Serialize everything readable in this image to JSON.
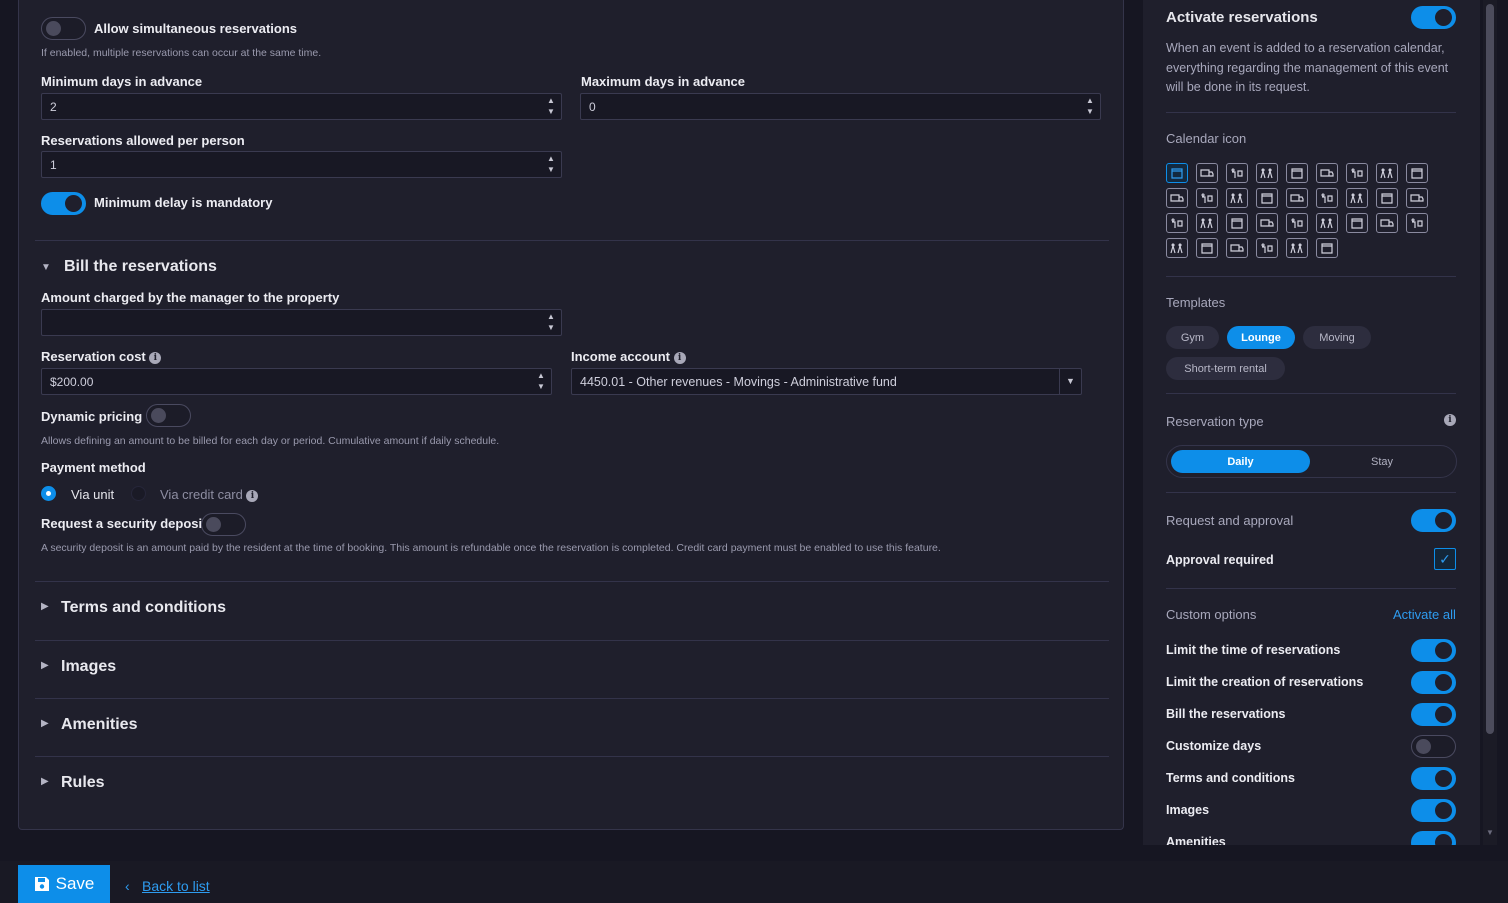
{
  "form": {
    "simultaneous": {
      "label": "Allow simultaneous reservations",
      "help": "If enabled, multiple reservations can occur at the same time."
    },
    "min_days": {
      "label": "Minimum days in advance",
      "value": "2"
    },
    "max_days": {
      "label": "Maximum days in advance",
      "value": "0"
    },
    "per_person": {
      "label": "Reservations allowed per person",
      "value": "1"
    },
    "min_delay": {
      "label": "Minimum delay is mandatory"
    },
    "billing": {
      "title": "Bill the reservations",
      "amount_charged": {
        "label": "Amount charged by the manager to the property",
        "value": ""
      },
      "cost": {
        "label": "Reservation cost",
        "value": "$200.00"
      },
      "income": {
        "label": "Income account",
        "value": "4450.01 - Other revenues - Movings - Administrative fund"
      },
      "dynamic": {
        "label": "Dynamic pricing",
        "help": "Allows defining an amount to be billed for each day or period. Cumulative amount if daily schedule."
      },
      "payment": {
        "label": "Payment method",
        "via_unit": "Via unit",
        "via_card": "Via credit card"
      },
      "deposit": {
        "label": "Request a security deposit",
        "help": "A security deposit is an amount paid by the resident at the time of booking. This amount is refundable once the reservation is completed. Credit card payment must be enabled to use this feature."
      }
    },
    "sections": [
      "Terms and conditions",
      "Images",
      "Amenities",
      "Rules"
    ]
  },
  "sidebar": {
    "activate": {
      "label": "Activate reservations",
      "help": "When an event is added to a reservation calendar, everything regarding the management of this event will be done in its request."
    },
    "calendar_icon": "Calendar icon",
    "templates": {
      "label": "Templates",
      "items": [
        "Gym",
        "Lounge",
        "Moving",
        "Short-term rental"
      ],
      "selected": "Lounge"
    },
    "reservation_type": {
      "label": "Reservation type",
      "options": [
        "Daily",
        "Stay"
      ],
      "selected": "Daily"
    },
    "request_approval": "Request and approval",
    "approval_required": "Approval required",
    "custom_options": {
      "label": "Custom options",
      "activate_all": "Activate all",
      "items": [
        {
          "label": "Limit the time of reservations",
          "on": true
        },
        {
          "label": "Limit the creation of reservations",
          "on": true
        },
        {
          "label": "Bill the reservations",
          "on": true
        },
        {
          "label": "Customize days",
          "on": false
        },
        {
          "label": "Terms and conditions",
          "on": true
        },
        {
          "label": "Images",
          "on": true
        },
        {
          "label": "Amenities",
          "on": true
        }
      ]
    }
  },
  "footer": {
    "save": "Save",
    "back": "Back to list"
  },
  "colors": {
    "accent": "#0d8ee9",
    "background": "#161622",
    "panel": "#1f1f2c"
  }
}
